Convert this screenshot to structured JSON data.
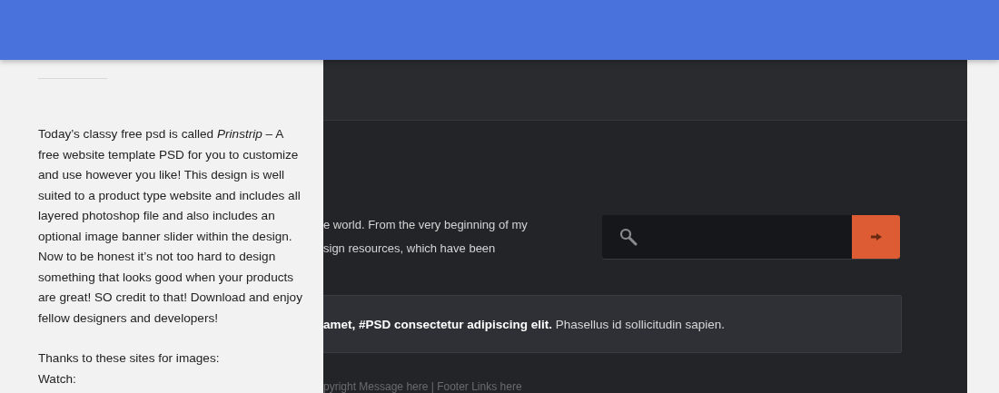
{
  "article": {
    "paragraph": "Today’s classy free psd is called *Prinstrip* – A free website template PSD for you to customize and use however you like! This design is well suited to a product type website and includes all layered photoshop file and also includes an optional image banner slider within the design. Now to be honest it’s not too hard to design something that looks good when your products are great! SO credit to that! Download and enjoy fellow designers and developers!",
    "credits": [
      "Thanks to these sites for images:",
      "Watch:"
    ]
  },
  "preview": {
    "intro_lines": [
      "e world. From the very beginning of my",
      "sign resources, which have been"
    ],
    "quote": "**amet, #PSD consectetur adipiscing elit.** Phasellus id sollicitudin sapien.",
    "footer": "pyright Message here | Footer Links here"
  }
}
